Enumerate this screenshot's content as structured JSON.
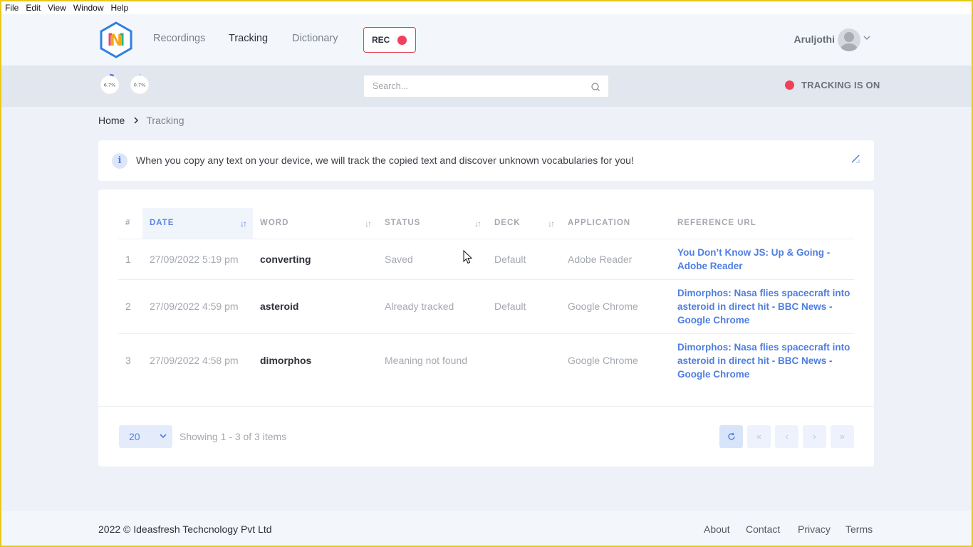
{
  "menubar": [
    "File",
    "Edit",
    "View",
    "Window",
    "Help"
  ],
  "nav": {
    "logo_letter": "N",
    "links": [
      "Recordings",
      "Tracking",
      "Dictionary"
    ],
    "active": "Tracking",
    "rec_label": "REC",
    "user_name": "Aruljothi"
  },
  "subbar": {
    "gauges": [
      {
        "label": "6.7%",
        "value": 6.7
      },
      {
        "label": "0.7%",
        "value": 0.7
      }
    ],
    "search_placeholder": "Search...",
    "tracking_status": "TRACKING IS ON"
  },
  "breadcrumb": {
    "home": "Home",
    "current": "Tracking"
  },
  "alert": {
    "text": "When you copy any text on your device, we will track the copied text and discover unknown vocabularies for you!"
  },
  "table": {
    "headers": [
      "#",
      "DATE",
      "WORD",
      "STATUS",
      "DECK",
      "APPLICATION",
      "REFERENCE URL"
    ],
    "rows": [
      {
        "num": "1",
        "date": "27/09/2022 5:19 pm",
        "word": "converting",
        "status": "Saved",
        "deck": "Default",
        "app": "Adobe Reader",
        "ref": "You Don’t Know JS: Up & Going - Adobe Reader"
      },
      {
        "num": "2",
        "date": "27/09/2022 4:59 pm",
        "word": "asteroid",
        "status": "Already tracked",
        "deck": "Default",
        "app": "Google Chrome",
        "ref": "Dimorphos: Nasa flies spacecraft into asteroid in direct hit - BBC News - Google Chrome"
      },
      {
        "num": "3",
        "date": "27/09/2022 4:58 pm",
        "word": "dimorphos",
        "status": "Meaning not found",
        "deck": "",
        "app": "Google Chrome",
        "ref": "Dimorphos: Nasa flies spacecraft into asteroid in direct hit - BBC News - Google Chrome"
      }
    ]
  },
  "pagination": {
    "page_size": "20",
    "showing": "Showing 1 - 3 of 3 items"
  },
  "footer": {
    "copyright": "2022 © Ideasfresh Techcnology Pvt Ltd",
    "links": [
      "About",
      "Contact",
      "Privacy",
      "Terms"
    ]
  }
}
